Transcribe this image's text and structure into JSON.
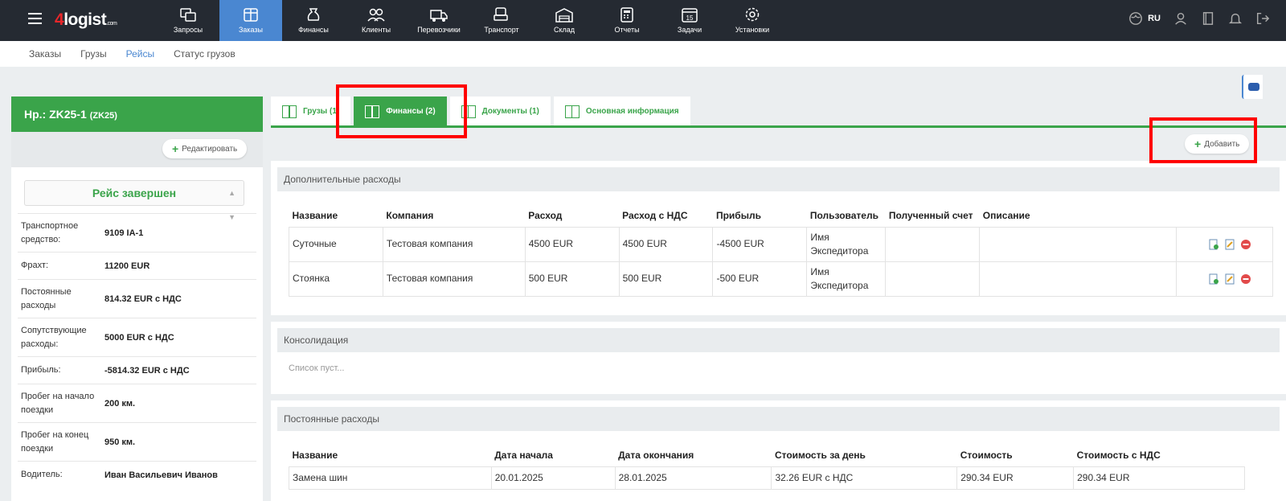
{
  "brand": {
    "four": "4",
    "name": "logist",
    "suffix": ".com"
  },
  "nav": [
    {
      "label": "Запросы",
      "icon": "requests-icon"
    },
    {
      "label": "Заказы",
      "icon": "orders-icon",
      "active": true
    },
    {
      "label": "Финансы",
      "icon": "finance-icon"
    },
    {
      "label": "Клиенты",
      "icon": "clients-icon"
    },
    {
      "label": "Перевозчики",
      "icon": "carriers-icon"
    },
    {
      "label": "Транспорт",
      "icon": "transport-icon"
    },
    {
      "label": "Склад",
      "icon": "warehouse-icon"
    },
    {
      "label": "Отчеты",
      "icon": "reports-icon"
    },
    {
      "label": "Задачи",
      "icon": "tasks-icon"
    },
    {
      "label": "Установки",
      "icon": "settings-icon"
    }
  ],
  "lang": "RU",
  "subnav": [
    {
      "label": "Заказы"
    },
    {
      "label": "Грузы"
    },
    {
      "label": "Рейсы",
      "active": true
    },
    {
      "label": "Статус грузов"
    }
  ],
  "trip": {
    "title": "Нр.: ZK25-1",
    "code": "(ZK25)",
    "edit_label": "Редактировать",
    "status": "Рейс завершен",
    "info": [
      {
        "key": "Транспортное средство:",
        "value": "9109 IA-1"
      },
      {
        "key": "Фрахт:",
        "value": "11200 EUR"
      },
      {
        "key": "Постоянные расходы",
        "value": "814.32 EUR с НДС"
      },
      {
        "key": "Сопутствующие расходы:",
        "value": "5000 EUR с НДС"
      },
      {
        "key": "Прибыль:",
        "value": "-5814.32 EUR с НДС"
      },
      {
        "key": "Пробег на начало поездки",
        "value": "200 км."
      },
      {
        "key": "Пробег на конец поездки",
        "value": "950 км."
      },
      {
        "key": "Водитель:",
        "value": "Иван Васильевич Иванов"
      }
    ]
  },
  "tabs": [
    {
      "label": "Грузы (1)"
    },
    {
      "label": "Финансы (2)",
      "active": true
    },
    {
      "label": "Документы (1)"
    },
    {
      "label": "Основная информация"
    }
  ],
  "add_label": "Добавить",
  "extra_costs": {
    "title": "Дополнительные расходы",
    "headers": [
      "Название",
      "Компания",
      "Расход",
      "Расход с НДС",
      "Прибыль",
      "Пользователь",
      "Полученный счет",
      "Описание"
    ],
    "rows": [
      [
        "Суточные",
        "Тестовая компания",
        "4500 EUR",
        "4500 EUR",
        "-4500 EUR",
        "Имя Экспедитора",
        "",
        ""
      ],
      [
        "Стоянка",
        "Тестовая компания",
        "500 EUR",
        "500 EUR",
        "-500 EUR",
        "Имя Экспедитора",
        "",
        ""
      ]
    ]
  },
  "consolidation": {
    "title": "Консолидация",
    "empty": "Список пуст..."
  },
  "fixed_costs": {
    "title": "Постоянные расходы",
    "headers": [
      "Название",
      "Дата начала",
      "Дата окончания",
      "Стоимость за день",
      "Стоимость",
      "Стоимость с НДС"
    ],
    "rows": [
      [
        "Замена шин",
        "20.01.2025",
        "28.01.2025",
        "32.26 EUR с НДС",
        "290.34 EUR",
        "290.34 EUR"
      ]
    ]
  },
  "colors": {
    "accent_green": "#3aa44a",
    "accent_blue": "#4a87d1",
    "highlight_red": "#ff0000"
  }
}
